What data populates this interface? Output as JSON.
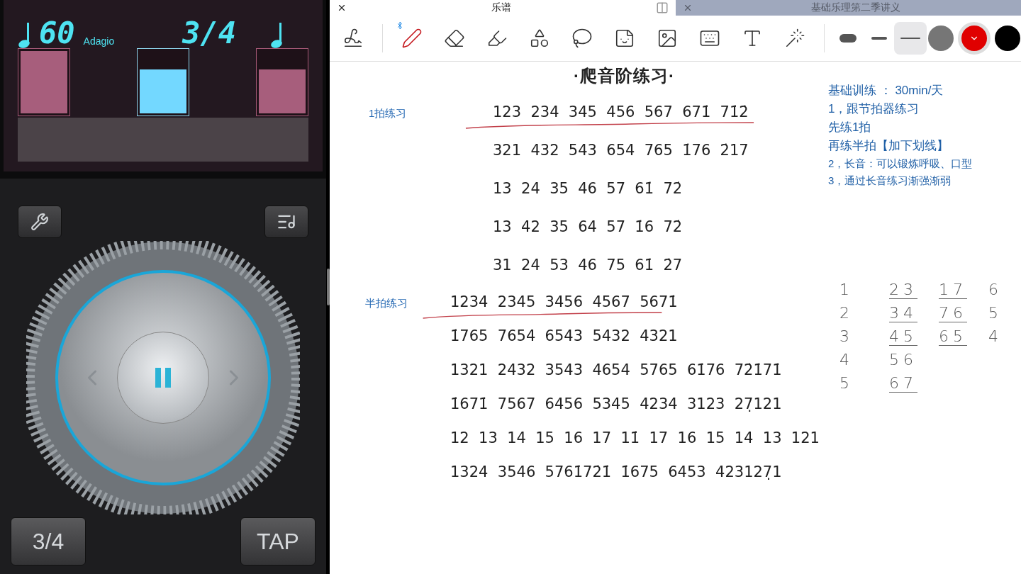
{
  "metronome": {
    "tempo": "60",
    "tempo_name": "Adagio",
    "time_signature": "3/4",
    "beats": [
      {
        "level": 1,
        "selected": false
      },
      {
        "level": 0.7,
        "selected": true
      },
      {
        "level": 0.7,
        "selected": false
      }
    ],
    "buttons": [
      "3/4",
      "TAP"
    ]
  },
  "tabs": [
    {
      "label": "乐谱",
      "selected": true
    },
    {
      "label": "基础乐理第二季讲义",
      "selected": false
    }
  ],
  "pen_sizes": [
    {
      "kind": "thick",
      "selected": false
    },
    {
      "kind": "medium",
      "selected": false
    },
    {
      "kind": "thin",
      "selected": true
    }
  ],
  "pen_colors": [
    {
      "color": "#767676",
      "selected": false
    },
    {
      "color": "#e00000",
      "selected": true
    },
    {
      "color": "#000000",
      "selected": false
    }
  ],
  "document": {
    "title": "·爬音阶练习·",
    "sections": [
      {
        "label": "1拍练习",
        "kind": "wide",
        "lines": [
          {
            "text": "123  234  345  456  567  671̇  71̇2̇",
            "underlined": true
          },
          {
            "text": "321  432  543  654  765  1̇76  2̇17",
            "underlined": false
          },
          {
            "text": "13  24  35  46  57  61̇  72̇",
            "underlined": false
          },
          {
            "text": "13  42  35  64  57  1̇6  72̇",
            "underlined": false
          },
          {
            "text": "31  24  53  46  75  61̇  2̇7",
            "underlined": false
          }
        ]
      },
      {
        "label": "半拍练习",
        "kind": "tight",
        "lines": [
          {
            "text": "1234  2345  3456  4567  5671̇",
            "underlined": true
          },
          {
            "text": "1̇765  7654  6543  5432  4321",
            "underlined": false
          },
          {
            "text": "1321  2432  3543  4654  5765  61̇76  72̇1̇71̇",
            "underlined": false
          },
          {
            "text": "1̇671̇  7567  6456  5345  4234  3123  27̣121",
            "underlined": false
          },
          {
            "text": "12  13  14  15  16  17  11̇  17  16  15  14  13  121",
            "underlined": false
          },
          {
            "text": "1324  3546  5761̇72̇1̇  1̇675  6453  423127̣1",
            "underlined": false
          }
        ]
      }
    ],
    "side_notes": [
      {
        "text": "基础训练 ：  30min/天",
        "kind": "large"
      },
      {
        "text": "1，跟节拍器练习",
        "kind": "large"
      },
      {
        "text": "先练1拍",
        "kind": "large"
      },
      {
        "text": "再练半拍【加下划线】",
        "kind": "large"
      },
      {
        "text": "2，长音：可以锻炼呼吸、口型",
        "kind": "small"
      },
      {
        "text": "3，通过长音练习渐强渐弱",
        "kind": "small"
      }
    ],
    "handwriting": [
      {
        "items": [
          {
            "text": "1",
            "underlined": false
          },
          {
            "text": "2",
            "underlined": false
          },
          {
            "text": "3",
            "underlined": false
          },
          {
            "text": "4",
            "underlined": false
          },
          {
            "text": "5",
            "underlined": false
          }
        ]
      },
      {
        "items": [
          {
            "text": "23",
            "underlined": true
          },
          {
            "text": "34",
            "underlined": true
          },
          {
            "text": "45",
            "underlined": true
          },
          {
            "text": "56",
            "underlined": false
          },
          {
            "text": "67",
            "underlined": true
          }
        ]
      },
      {
        "items": [
          {
            "text": "17",
            "underlined": true
          },
          {
            "text": "76",
            "underlined": true
          },
          {
            "text": "65",
            "underlined": true
          }
        ]
      },
      {
        "items": [
          {
            "text": "6",
            "underlined": false
          },
          {
            "text": "5",
            "underlined": false
          },
          {
            "text": "4",
            "underlined": false
          }
        ]
      }
    ]
  }
}
